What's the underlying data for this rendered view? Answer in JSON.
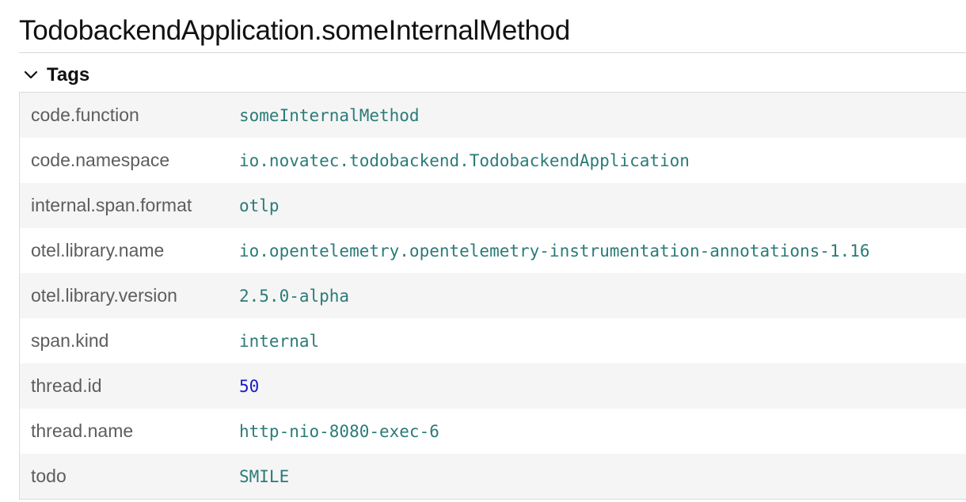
{
  "span": {
    "title": "TodobackendApplication.someInternalMethod"
  },
  "tags_section": {
    "label": "Tags",
    "expanded": true,
    "icon": "chevron-down-icon",
    "colors": {
      "key_text": "#5d5d5d",
      "string_value": "#2a7b78",
      "number_value": "#1a1acd",
      "odd_row_background": "#f5f5f5"
    },
    "rows": [
      {
        "key": "code.function",
        "value": "someInternalMethod"
      },
      {
        "key": "code.namespace",
        "value": "io.novatec.todobackend.TodobackendApplication"
      },
      {
        "key": "internal.span.format",
        "value": "otlp"
      },
      {
        "key": "otel.library.name",
        "value": "io.opentelemetry.opentelemetry-instrumentation-annotations-1.16"
      },
      {
        "key": "otel.library.version",
        "value": "2.5.0-alpha"
      },
      {
        "key": "span.kind",
        "value": "internal"
      },
      {
        "key": "thread.id",
        "value": "50"
      },
      {
        "key": "thread.name",
        "value": "http-nio-8080-exec-6"
      },
      {
        "key": "todo",
        "value": "SMILE"
      }
    ]
  }
}
